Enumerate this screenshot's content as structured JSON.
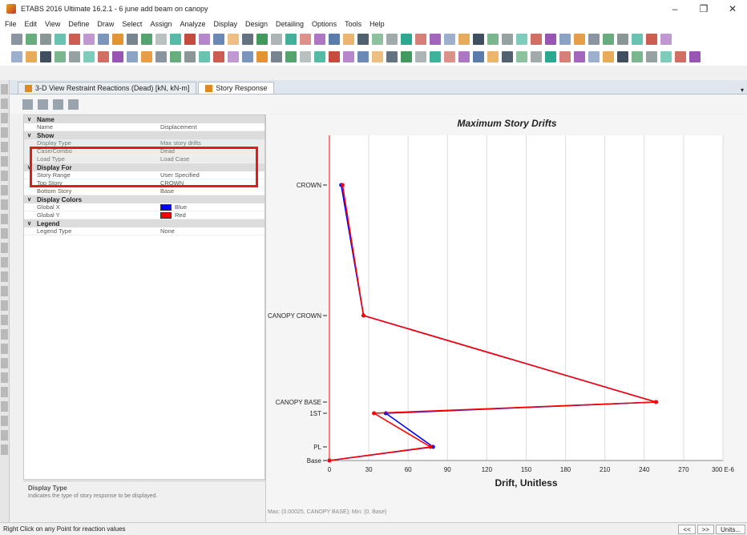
{
  "window": {
    "title": "ETABS 2016 Ultimate 16.2.1 - 6 june add beam on canopy",
    "controls": [
      "–",
      "❐",
      "✕"
    ]
  },
  "menu": [
    "File",
    "Edit",
    "View",
    "Define",
    "Draw",
    "Select",
    "Assign",
    "Analyze",
    "Display",
    "Design",
    "Detailing",
    "Options",
    "Tools",
    "Help"
  ],
  "tabs": [
    {
      "label": "3-D View  Restraint Reactions  (Dead)  [kN, kN-m]",
      "active": false
    },
    {
      "label": "Story Response",
      "active": true
    }
  ],
  "properties": [
    {
      "group": "Name",
      "rows": [
        {
          "key": "Name",
          "value": "Displacement"
        }
      ]
    },
    {
      "group": "Show",
      "rows": [
        {
          "key": "Display Type",
          "value": "Max story drifts",
          "shaded": true
        },
        {
          "key": "Case/Combo",
          "value": "Dead",
          "shaded": true
        },
        {
          "key": "Load Type",
          "value": "Load Case",
          "shaded": true
        }
      ]
    },
    {
      "group": "Display For",
      "rows": [
        {
          "key": "Story Range",
          "value": "User Specified"
        },
        {
          "key": "Top Story",
          "value": "CROWN"
        },
        {
          "key": "Bottom Story",
          "value": "Base"
        }
      ]
    },
    {
      "group": "Display Colors",
      "rows": [
        {
          "key": "Global X",
          "value": "Blue",
          "swatch": "#0000ff"
        },
        {
          "key": "Global Y",
          "value": "Red",
          "swatch": "#ff0000"
        }
      ]
    },
    {
      "group": "Legend",
      "rows": [
        {
          "key": "Legend Type",
          "value": "None"
        }
      ]
    }
  ],
  "description": {
    "title": "Display Type",
    "text": "Indicates the type of story response to be displayed."
  },
  "chart_data": {
    "type": "line",
    "title": "Maximum Story Drifts",
    "xlabel": "Drift, Unitless",
    "x_unit_label": "E-6",
    "xlim": [
      0,
      300
    ],
    "xticks": [
      0,
      30,
      60,
      90,
      120,
      150,
      180,
      210,
      240,
      270,
      300
    ],
    "stories": [
      "Base",
      "PL",
      "1ST",
      "CANOPY BASE",
      "CANOPY CROWN",
      "CROWN"
    ],
    "grid": true,
    "series": [
      {
        "name": "Global X",
        "color": "#0000ff",
        "values": [
          0,
          79,
          43,
          249,
          26,
          9
        ]
      },
      {
        "name": "Global Y",
        "color": "#ff0000",
        "values": [
          0,
          77,
          34,
          249,
          26,
          10
        ]
      }
    ]
  },
  "plot_footer": "Max: (0.00025, CANOPY BASE);  Min: (0, Base)",
  "status": {
    "text": "Right Click on any Point for reaction values",
    "buttons": [
      "<<",
      ">>",
      "Units..."
    ]
  }
}
